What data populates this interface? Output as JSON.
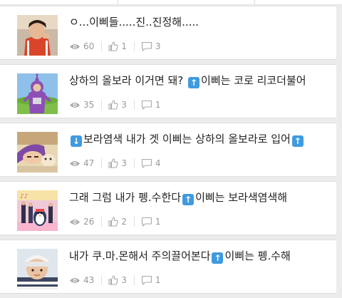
{
  "posts": [
    {
      "title_parts": [
        "ㅇ...이삐들.....진..진정해....."
      ],
      "views": "60",
      "likes": "1",
      "comments": "3",
      "thumb": "orange-hoodie-person"
    },
    {
      "title_parts": [
        "상하의 올보라 이거면 돼? ",
        "up",
        "이삐는 코로 리코더불어"
      ],
      "views": "35",
      "likes": "3",
      "comments": "1",
      "thumb": "purple-teletubby"
    },
    {
      "title_parts": [
        "down",
        "보라염색 내가 겟 이삐는 상하의 올보라로 입어",
        "up"
      ],
      "views": "47",
      "likes": "3",
      "comments": "4",
      "thumb": "cartoon-purple-hair"
    },
    {
      "title_parts": [
        "그래 그럼 내가 펭.수한다",
        "up",
        "이삐는 보라색염색해"
      ],
      "views": "26",
      "likes": "2",
      "comments": "1",
      "thumb": "dance-group-pengsoo"
    },
    {
      "title_parts": [
        "내가 쿠.마.몬해서 주의끌어본다",
        "up",
        "이삐는 펭.수해"
      ],
      "views": "43",
      "likes": "3",
      "comments": "1",
      "thumb": "person-beanie"
    }
  ],
  "icons": {
    "views": "eye-icon",
    "likes": "thumbs-up-icon",
    "comments": "comment-bubble-icon",
    "up": "up-arrow-emoji-icon",
    "down": "down-arrow-emoji-icon"
  },
  "colors": {
    "accent_blue": "#3f9be0",
    "meta_gray": "#999999",
    "title_text": "#222222"
  }
}
